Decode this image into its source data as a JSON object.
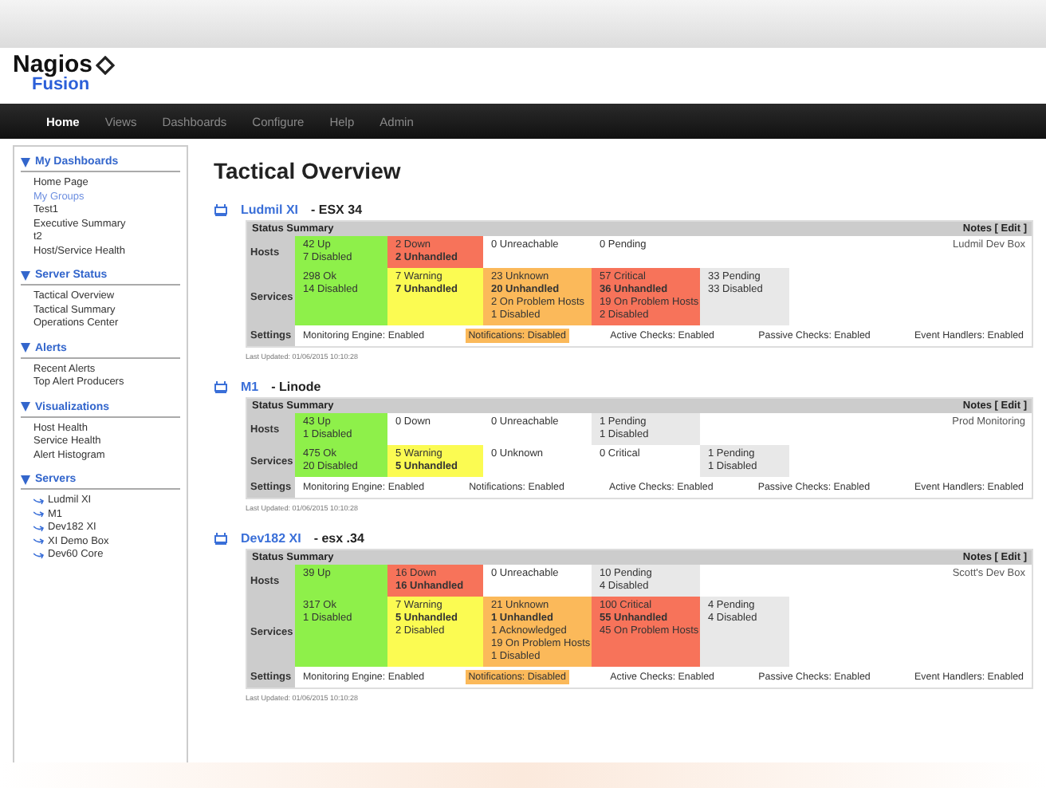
{
  "logo": {
    "name": "Nagios",
    "product": "Fusion"
  },
  "nav": [
    {
      "label": "Home",
      "selected": true
    },
    {
      "label": "Views",
      "selected": false
    },
    {
      "label": "Dashboards",
      "selected": false
    },
    {
      "label": "Configure",
      "selected": false
    },
    {
      "label": "Help",
      "selected": false
    },
    {
      "label": "Admin",
      "selected": false
    }
  ],
  "sidebar": [
    {
      "title": "My Dashboards",
      "kind": "links",
      "items": [
        {
          "label": "Home Page",
          "selected": false
        },
        {
          "label": "My Groups",
          "selected": true
        },
        {
          "label": "Test1",
          "selected": false
        },
        {
          "label": "Executive Summary",
          "selected": false
        },
        {
          "label": "t2",
          "selected": false
        },
        {
          "label": "Host/Service Health",
          "selected": false
        }
      ]
    },
    {
      "title": "Server Status",
      "kind": "links",
      "items": [
        {
          "label": "Tactical Overview",
          "selected": false
        },
        {
          "label": "Tactical Summary",
          "selected": false
        },
        {
          "label": "Operations Center",
          "selected": false
        }
      ]
    },
    {
      "title": "Alerts",
      "kind": "links",
      "items": [
        {
          "label": "Recent Alerts",
          "selected": false
        },
        {
          "label": "Top Alert Producers",
          "selected": false
        }
      ]
    },
    {
      "title": "Visualizations",
      "kind": "links",
      "items": [
        {
          "label": "Host Health",
          "selected": false
        },
        {
          "label": "Service Health",
          "selected": false
        },
        {
          "label": "Alert Histogram",
          "selected": false
        }
      ]
    },
    {
      "title": "Servers",
      "kind": "servers",
      "items": [
        {
          "label": "Ludmil XI",
          "selected": false
        },
        {
          "label": "M1",
          "selected": false
        },
        {
          "label": "Dev182 XI",
          "selected": false
        },
        {
          "label": "XI Demo Box",
          "selected": false
        },
        {
          "label": "Dev60 Core",
          "selected": false
        }
      ]
    }
  ],
  "page_title": "Tactical Overview",
  "servers": [
    {
      "name": "Ludmil XI",
      "description": "- ESX 34",
      "header_title": "Status Summary",
      "notes_label": "Notes [ Edit ]",
      "row_labels": [
        "Hosts",
        "Services",
        "Settings"
      ],
      "hosts": [
        {
          "kind": "ok",
          "lines": [
            {
              "text": "42 Up",
              "bold": false
            },
            {
              "text": "7 Disabled",
              "bold": false
            }
          ]
        },
        {
          "kind": "critical",
          "lines": [
            {
              "text": "2 Down",
              "bold": false
            },
            {
              "text": "2 Unhandled",
              "bold": true
            }
          ]
        },
        {
          "kind": "none",
          "lines": [
            {
              "text": "0 Unreachable",
              "bold": false
            }
          ]
        },
        {
          "kind": "none",
          "lines": [
            {
              "text": "0 Pending",
              "bold": false
            }
          ]
        }
      ],
      "services": [
        {
          "kind": "ok",
          "lines": [
            {
              "text": "298 Ok",
              "bold": false
            },
            {
              "text": "14 Disabled",
              "bold": false
            }
          ]
        },
        {
          "kind": "warning",
          "lines": [
            {
              "text": "7 Warning",
              "bold": false
            },
            {
              "text": "7 Unhandled",
              "bold": true
            }
          ]
        },
        {
          "kind": "unknown",
          "lines": [
            {
              "text": "23 Unknown",
              "bold": false
            },
            {
              "text": "20 Unhandled",
              "bold": true
            },
            {
              "text": "2 On Problem Hosts",
              "bold": false
            },
            {
              "text": "1 Disabled",
              "bold": false
            }
          ]
        },
        {
          "kind": "critical",
          "lines": [
            {
              "text": "57 Critical",
              "bold": false
            },
            {
              "text": "36 Unhandled",
              "bold": true
            },
            {
              "text": "19 On Problem Hosts",
              "bold": false
            },
            {
              "text": "2 Disabled",
              "bold": false
            }
          ]
        },
        {
          "kind": "pending",
          "lines": [
            {
              "text": "33 Pending",
              "bold": false
            },
            {
              "text": "33 Disabled",
              "bold": false
            }
          ]
        }
      ],
      "notes": "Ludmil Dev Box",
      "settings": [
        {
          "text": "Monitoring Engine: Enabled",
          "highlighted": false
        },
        {
          "text": "Notifications: Disabled",
          "highlighted": true
        },
        {
          "text": "Active Checks: Enabled",
          "highlighted": false
        },
        {
          "text": "Passive Checks: Enabled",
          "highlighted": false
        },
        {
          "text": "Event Handlers: Enabled",
          "highlighted": false
        }
      ],
      "last_updated": "Last Updated: 01/06/2015 10:10:28"
    },
    {
      "name": "M1",
      "description": "- Linode",
      "header_title": "Status Summary",
      "notes_label": "Notes [ Edit ]",
      "row_labels": [
        "Hosts",
        "Services",
        "Settings"
      ],
      "hosts": [
        {
          "kind": "ok",
          "lines": [
            {
              "text": "43 Up",
              "bold": false
            },
            {
              "text": "1 Disabled",
              "bold": false
            }
          ]
        },
        {
          "kind": "none",
          "lines": [
            {
              "text": "0 Down",
              "bold": false
            }
          ]
        },
        {
          "kind": "none",
          "lines": [
            {
              "text": "0 Unreachable",
              "bold": false
            }
          ]
        },
        {
          "kind": "pending",
          "lines": [
            {
              "text": "1 Pending",
              "bold": false
            },
            {
              "text": "1 Disabled",
              "bold": false
            }
          ]
        }
      ],
      "services": [
        {
          "kind": "ok",
          "lines": [
            {
              "text": "475 Ok",
              "bold": false
            },
            {
              "text": "20 Disabled",
              "bold": false
            }
          ]
        },
        {
          "kind": "warning",
          "lines": [
            {
              "text": "5 Warning",
              "bold": false
            },
            {
              "text": "5 Unhandled",
              "bold": true
            }
          ]
        },
        {
          "kind": "none",
          "lines": [
            {
              "text": "0 Unknown",
              "bold": false
            }
          ]
        },
        {
          "kind": "none",
          "lines": [
            {
              "text": "0 Critical",
              "bold": false
            }
          ]
        },
        {
          "kind": "pending",
          "lines": [
            {
              "text": "1 Pending",
              "bold": false
            },
            {
              "text": "1 Disabled",
              "bold": false
            }
          ]
        }
      ],
      "notes": "Prod Monitoring",
      "settings": [
        {
          "text": "Monitoring Engine: Enabled",
          "highlighted": false
        },
        {
          "text": "Notifications: Enabled",
          "highlighted": false
        },
        {
          "text": "Active Checks: Enabled",
          "highlighted": false
        },
        {
          "text": "Passive Checks: Enabled",
          "highlighted": false
        },
        {
          "text": "Event Handlers: Enabled",
          "highlighted": false
        }
      ],
      "last_updated": "Last Updated: 01/06/2015 10:10:28"
    },
    {
      "name": "Dev182 XI",
      "description": "- esx .34",
      "header_title": "Status Summary",
      "notes_label": "Notes [ Edit ]",
      "row_labels": [
        "Hosts",
        "Services",
        "Settings"
      ],
      "hosts": [
        {
          "kind": "ok",
          "lines": [
            {
              "text": "39 Up",
              "bold": false
            }
          ]
        },
        {
          "kind": "critical",
          "lines": [
            {
              "text": "16 Down",
              "bold": false
            },
            {
              "text": "16 Unhandled",
              "bold": true
            }
          ]
        },
        {
          "kind": "none",
          "lines": [
            {
              "text": "0 Unreachable",
              "bold": false
            }
          ]
        },
        {
          "kind": "pending",
          "lines": [
            {
              "text": "10 Pending",
              "bold": false
            },
            {
              "text": "4 Disabled",
              "bold": false
            }
          ]
        }
      ],
      "services": [
        {
          "kind": "ok",
          "lines": [
            {
              "text": "317 Ok",
              "bold": false
            },
            {
              "text": "1 Disabled",
              "bold": false
            }
          ]
        },
        {
          "kind": "warning",
          "lines": [
            {
              "text": "7 Warning",
              "bold": false
            },
            {
              "text": "5 Unhandled",
              "bold": true
            },
            {
              "text": "2 Disabled",
              "bold": false
            }
          ]
        },
        {
          "kind": "unknown",
          "lines": [
            {
              "text": "21 Unknown",
              "bold": false
            },
            {
              "text": "1 Unhandled",
              "bold": true
            },
            {
              "text": "1 Acknowledged",
              "bold": false
            },
            {
              "text": "19 On Problem Hosts",
              "bold": false
            },
            {
              "text": "1 Disabled",
              "bold": false
            }
          ]
        },
        {
          "kind": "critical",
          "lines": [
            {
              "text": "100 Critical",
              "bold": false
            },
            {
              "text": "55 Unhandled",
              "bold": true
            },
            {
              "text": "45 On Problem Hosts",
              "bold": false
            }
          ]
        },
        {
          "kind": "pending",
          "lines": [
            {
              "text": "4 Pending",
              "bold": false
            },
            {
              "text": "4 Disabled",
              "bold": false
            }
          ]
        }
      ],
      "notes": "Scott's Dev Box",
      "settings": [
        {
          "text": "Monitoring Engine: Enabled",
          "highlighted": false
        },
        {
          "text": "Notifications: Disabled",
          "highlighted": true
        },
        {
          "text": "Active Checks: Enabled",
          "highlighted": false
        },
        {
          "text": "Passive Checks: Enabled",
          "highlighted": false
        },
        {
          "text": "Event Handlers: Enabled",
          "highlighted": false
        }
      ],
      "last_updated": "Last Updated: 01/06/2015 10:10:28"
    }
  ]
}
